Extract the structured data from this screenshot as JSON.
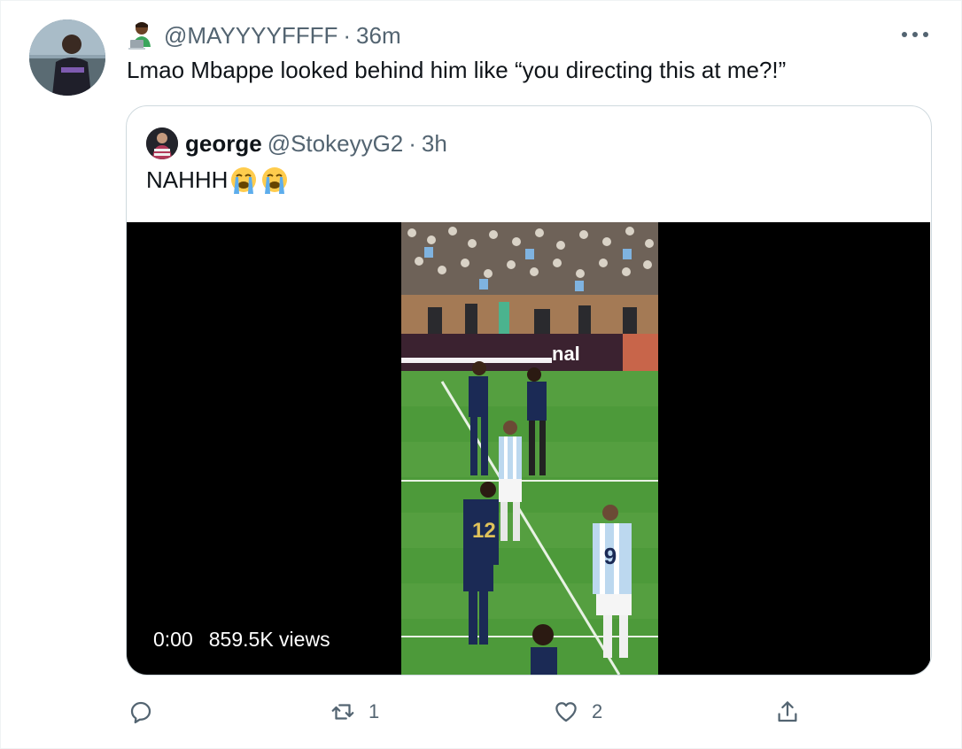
{
  "tweet": {
    "handle": "@MAYYYYFFFF",
    "separator": "·",
    "time": "36m",
    "text": "Lmao Mbappe looked behind him like “you directing this at me?!”",
    "avatar_icon": "profile-photo",
    "badge_icon": "technologist-emoji",
    "more_icon": "more-horizontal-icon"
  },
  "quote": {
    "name": "george",
    "handle": "@StokeyyG2",
    "separator": "·",
    "time": "3h",
    "text": "NAHHH",
    "emojis": [
      "loudly-crying-face",
      "loudly-crying-face"
    ],
    "video": {
      "timestamp": "0:00",
      "views": "859.5K views",
      "banner_text": "nal",
      "players": [
        "12",
        "9"
      ]
    }
  },
  "actions": {
    "reply": {
      "icon": "reply-icon",
      "count": ""
    },
    "retweet": {
      "icon": "retweet-icon",
      "count": "1"
    },
    "like": {
      "icon": "heart-icon",
      "count": "2"
    },
    "share": {
      "icon": "share-icon",
      "count": ""
    }
  },
  "colors": {
    "text_primary": "#0f1419",
    "text_secondary": "#536471",
    "border": "#cfd9de",
    "pitch": "#4d9a3a"
  }
}
